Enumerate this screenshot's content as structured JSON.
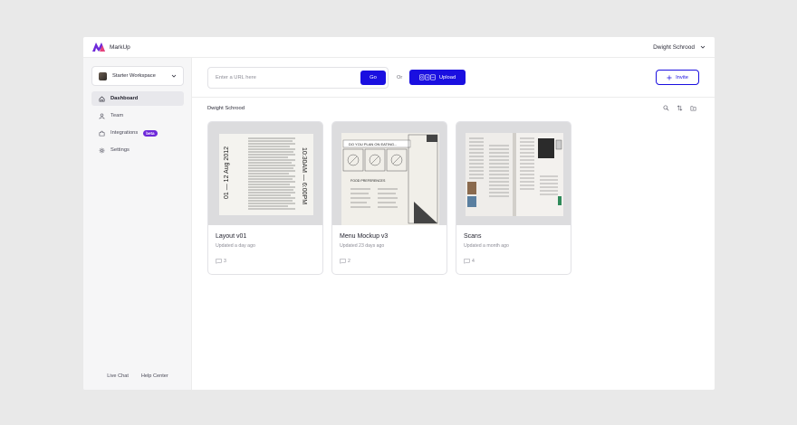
{
  "app": {
    "name": "MarkUp",
    "user": "Dwight Schrood"
  },
  "sidebar": {
    "workspace": "Starter Workspace",
    "items": [
      {
        "label": "Dashboard",
        "icon": "home-icon",
        "active": true
      },
      {
        "label": "Team",
        "icon": "user-icon"
      },
      {
        "label": "Integrations",
        "icon": "puzzle-icon",
        "badge": "beta"
      },
      {
        "label": "Settings",
        "icon": "gear-icon"
      }
    ],
    "footer": {
      "live_chat": "Live Chat",
      "help_center": "Help Center"
    }
  },
  "toolbar": {
    "url_placeholder": "Enter a URL here",
    "go_label": "Go",
    "or_label": "Or",
    "upload_label": "Upload",
    "invite_label": "Invite"
  },
  "section": {
    "title": "Dwight Schrood"
  },
  "cards": [
    {
      "title": "Layout v01",
      "updated": "Updated a day ago",
      "comments": "3",
      "thumb_text": "01 — 12 Aug 2012",
      "thumb_text2": "10:30AM — 6:00PM"
    },
    {
      "title": "Menu Mockup v3",
      "updated": "Updated 23 days ago",
      "comments": "2",
      "thumb_text": "DO YOU PLAN ON EATING...",
      "thumb_text2": "FOOD PREFERENCES"
    },
    {
      "title": "Scans",
      "updated": "Updated a month ago",
      "comments": "4"
    }
  ],
  "colors": {
    "accent": "#1a0fe0",
    "beta": "#6d28d9",
    "sidebar_bg": "#f6f6f7"
  }
}
